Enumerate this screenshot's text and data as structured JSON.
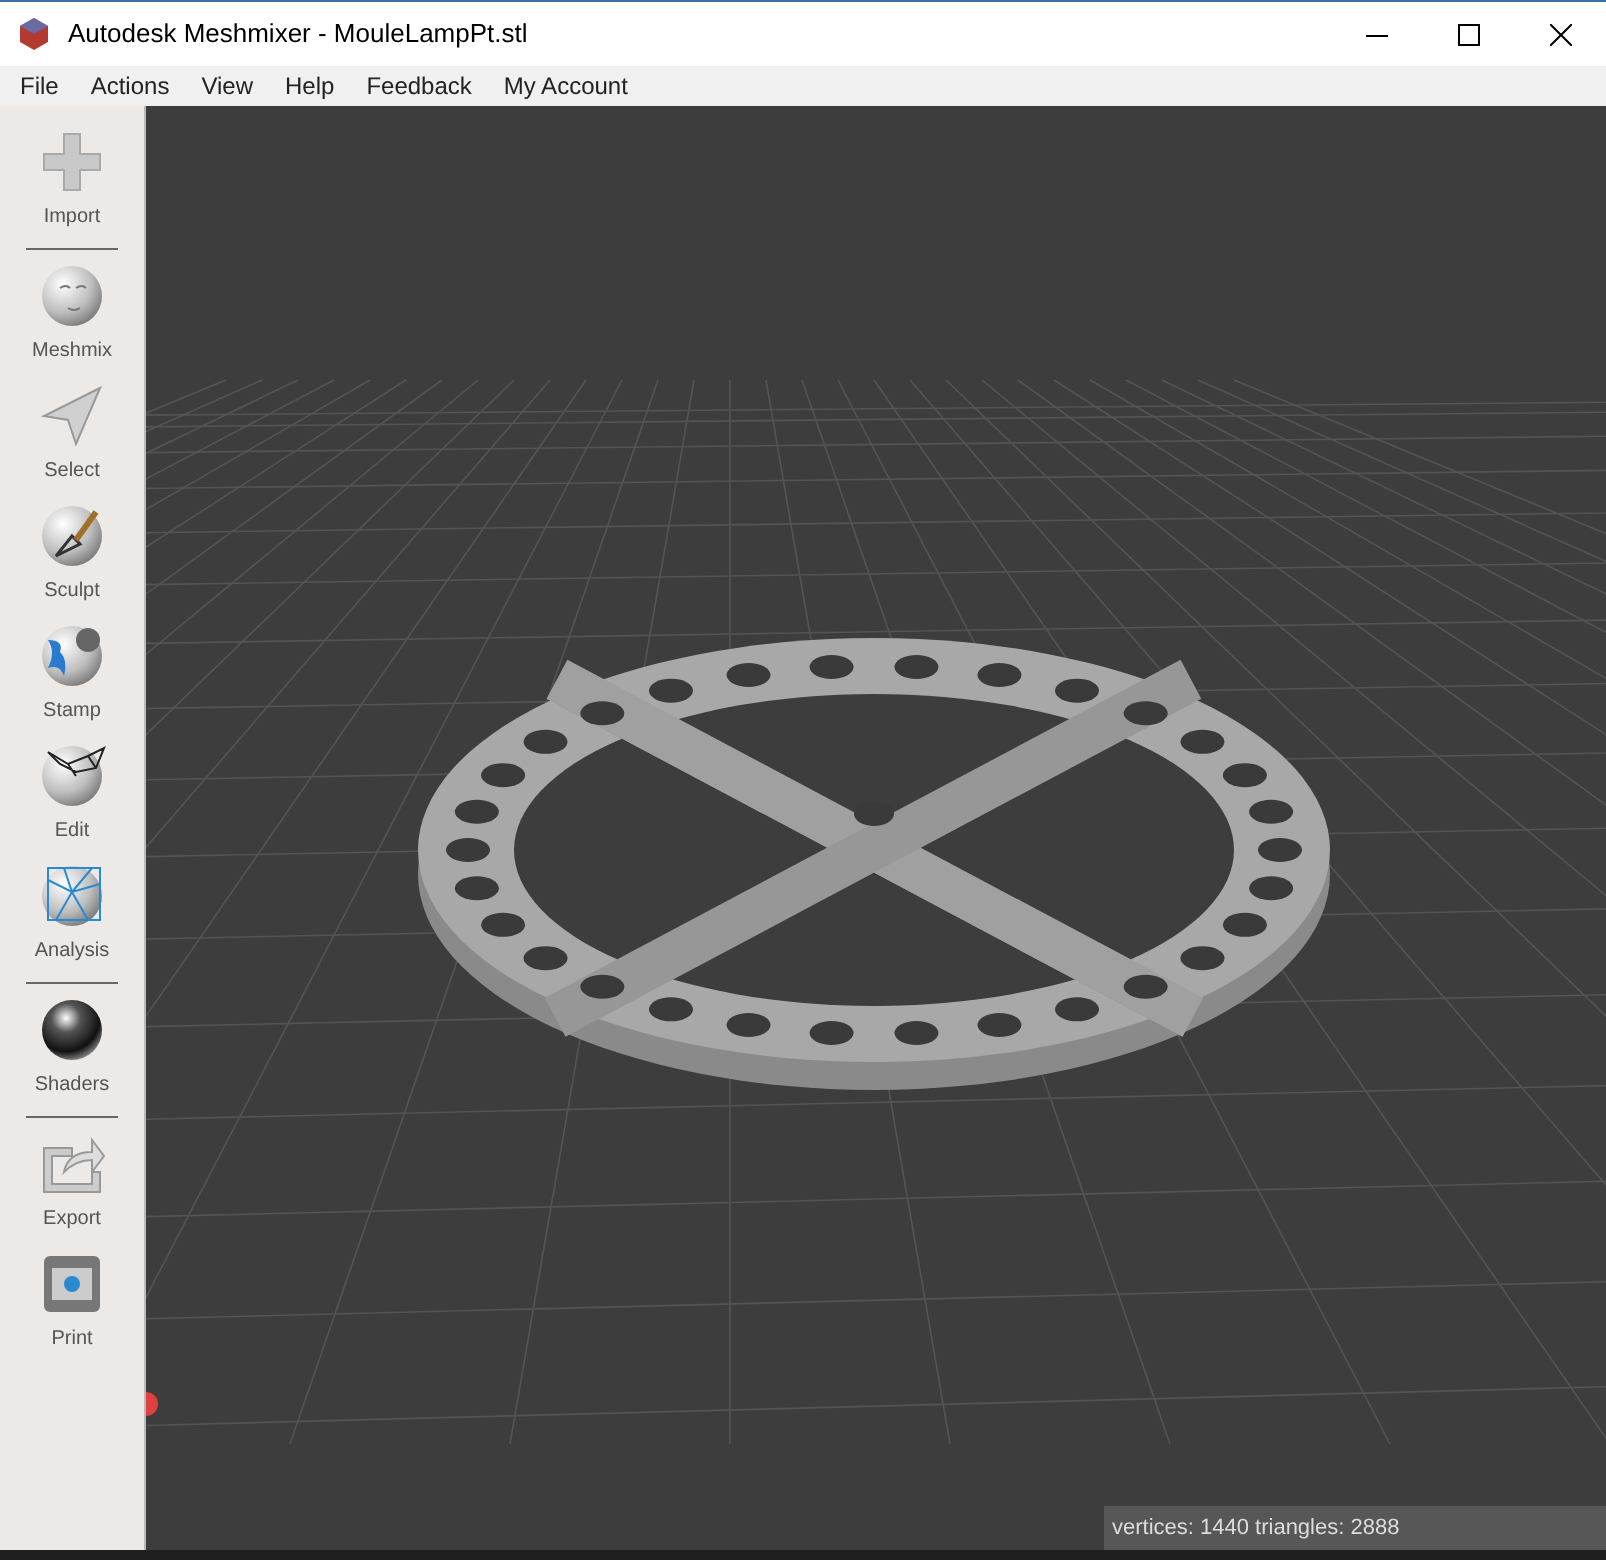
{
  "window": {
    "title": "Autodesk Meshmixer - MouleLampPt.stl"
  },
  "menu": [
    "File",
    "Actions",
    "View",
    "Help",
    "Feedback",
    "My Account"
  ],
  "sidebar": {
    "items": [
      {
        "kind": "plus",
        "label": "Import"
      },
      {
        "kind": "separator"
      },
      {
        "kind": "face",
        "label": "Meshmix"
      },
      {
        "kind": "arrow",
        "label": "Select"
      },
      {
        "kind": "brush",
        "label": "Sculpt"
      },
      {
        "kind": "stamp",
        "label": "Stamp"
      },
      {
        "kind": "mesh",
        "label": "Edit"
      },
      {
        "kind": "net",
        "label": "Analysis"
      },
      {
        "kind": "separator"
      },
      {
        "kind": "chrome",
        "label": "Shaders"
      },
      {
        "kind": "separator"
      },
      {
        "kind": "export",
        "label": "Export"
      },
      {
        "kind": "printer",
        "label": "Print"
      }
    ]
  },
  "status_bar": "vertices: 1440 triangles: 2888"
}
